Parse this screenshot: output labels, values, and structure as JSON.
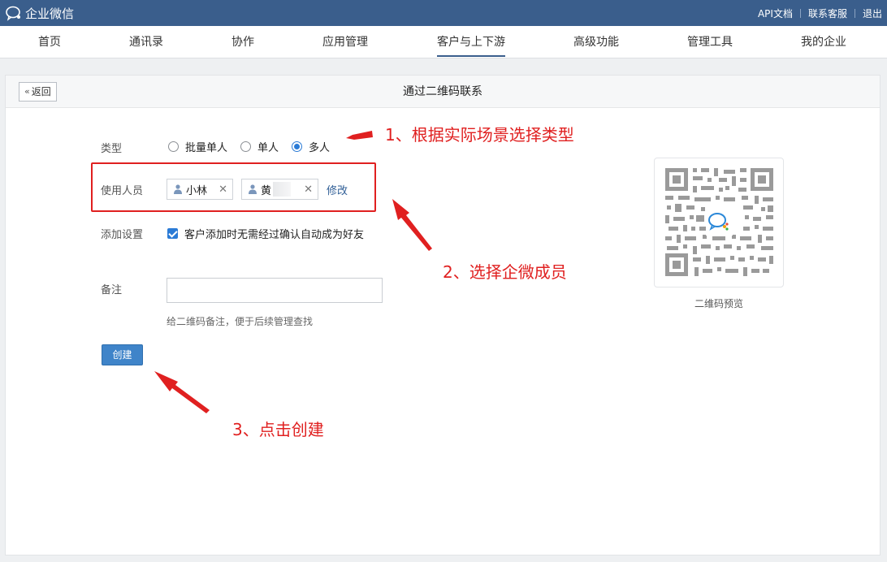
{
  "app": {
    "title": "企业微信",
    "logo_icon": "wecom-logo-icon"
  },
  "toplinks": [
    "API文档",
    "联系客服",
    "退出"
  ],
  "nav": {
    "items": [
      "首页",
      "通讯录",
      "协作",
      "应用管理",
      "客户与上下游",
      "高级功能",
      "管理工具",
      "我的企业"
    ],
    "active": "客户与上下游"
  },
  "page": {
    "back_label": "返回",
    "title": "通过二维码联系"
  },
  "form": {
    "type_label": "类型",
    "type_options": [
      "批量单人",
      "单人",
      "多人"
    ],
    "type_selected": "多人",
    "members_label": "使用人员",
    "members": [
      {
        "name": "小林"
      },
      {
        "name": "黄"
      }
    ],
    "modify_label": "修改",
    "settings_label": "添加设置",
    "auto_accept_label": "客户添加时无需经过确认自动成为好友",
    "auto_accept_checked": true,
    "note_label": "备注",
    "note_value": "",
    "note_hint": "给二维码备注，便于后续管理查找",
    "create_label": "创建"
  },
  "qr": {
    "caption": "二维码预览"
  },
  "annotations": {
    "step1": "1、根据实际场景选择类型",
    "step2": "2、选择企微成员",
    "step3": "3、点击创建",
    "color": "#e02020"
  },
  "colors": {
    "topbar": "#3a5e8c",
    "primary": "#3f84c9",
    "link": "#2f5e96"
  }
}
